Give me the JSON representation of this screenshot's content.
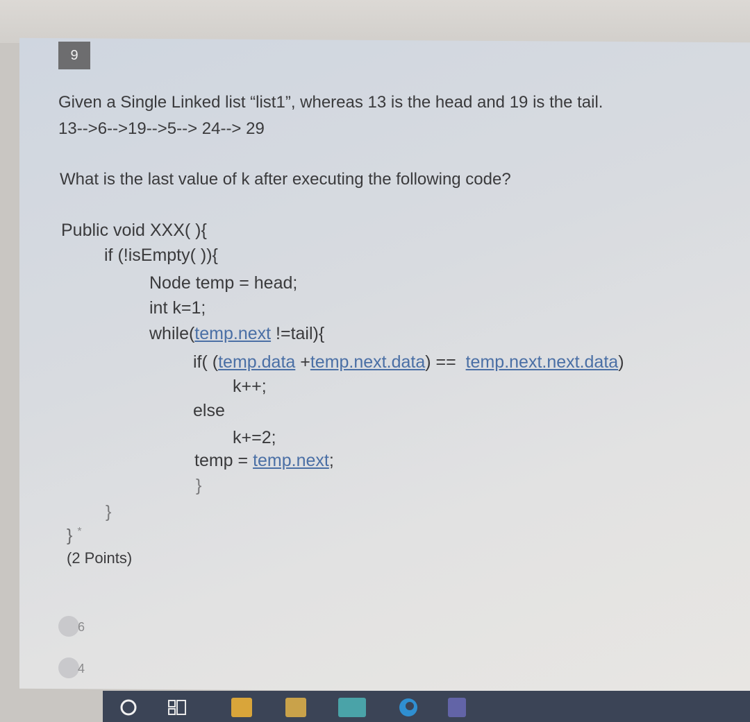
{
  "question": {
    "number": "9",
    "line1": "Given a Single Linked list “list1”, whereas 13 is the head and 19 is the tail.",
    "line2": "13-->6-->19-->5--> 24--> 29",
    "prompt": "What is the last value of k after executing the following code?",
    "points": "(2 Points)"
  },
  "code": {
    "l1": "Public void XXX( ){",
    "l2": "if (!isEmpty( )){",
    "l3": "Node temp = head;",
    "l4": "int k=1;",
    "l5_pre": "while(",
    "l5_link": "temp.next",
    "l5_post": " !=tail){",
    "l6_pre": "if( (",
    "l6_link1": "temp.data",
    "l6_mid1": " +",
    "l6_link2": "temp.next.data",
    "l6_mid2": ") ==  ",
    "l6_link3": "temp.next.next.data",
    "l6_post": ")",
    "l7": "k++;",
    "l8": "else",
    "l9": "k+=2;",
    "l10_pre": "temp = ",
    "l10_link": "temp.next",
    "l10_post": ";",
    "l11": "}",
    "l12": "}",
    "l13": "}",
    "required_mark": "*"
  },
  "options": [
    {
      "label": "6"
    },
    {
      "label": "4"
    }
  ],
  "taskbar": {
    "icons": [
      "search-circle-icon",
      "task-view-icon",
      "store-icon",
      "photos-icon",
      "mail-icon",
      "edge-icon",
      "teams-icon"
    ],
    "colors": {
      "bar": "#3b4456",
      "store": "#d9a53a",
      "photos": "#c9a24a",
      "mail": "#4aa3a8",
      "edge": "#2f8fd1",
      "teams": "#6264a7"
    }
  }
}
